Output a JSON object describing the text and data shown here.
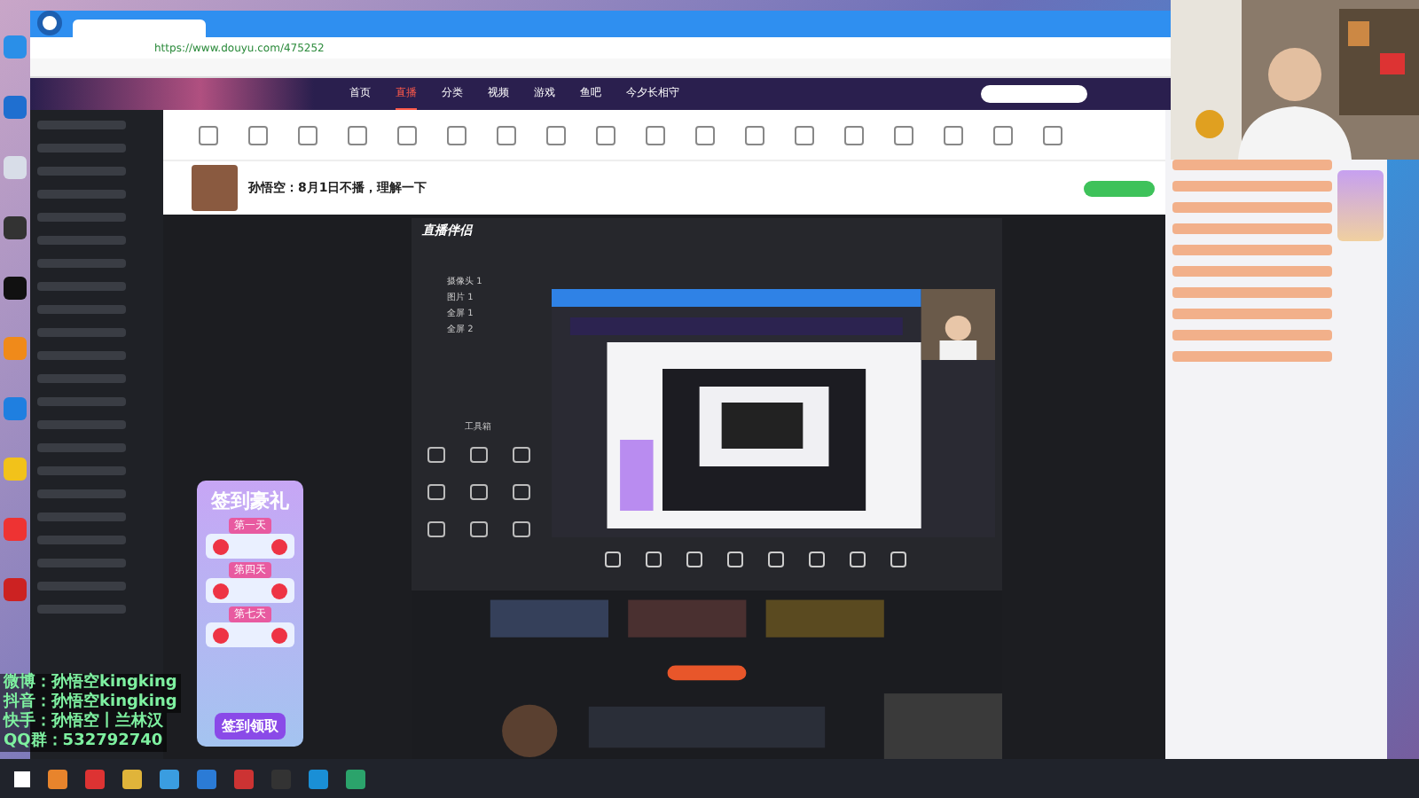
{
  "browser": {
    "url": "https://www.douyu.com/475252"
  },
  "nav": [
    {
      "label": "首页",
      "selected": false
    },
    {
      "label": "直播",
      "selected": true
    },
    {
      "label": "分类",
      "selected": false
    },
    {
      "label": "视频",
      "selected": false
    },
    {
      "label": "游戏",
      "selected": false
    },
    {
      "label": "鱼吧",
      "selected": false
    },
    {
      "label": "今夕长相守",
      "selected": false
    }
  ],
  "stream": {
    "title": "孙悟空：8月1日不播，理解一下"
  },
  "signin_card": {
    "title": "签到豪礼",
    "days": [
      "第一天",
      "第四天",
      "第七天"
    ],
    "button": "签到领取"
  },
  "streamer_app": {
    "name": "直播伴侣",
    "scenes": [
      "摄像头 1",
      "图片 1",
      "全屏 1",
      "全屏 2"
    ],
    "toolbox": "工具箱"
  },
  "social_overlay": [
    {
      "platform": "微博：",
      "handle": "孙悟空kingking"
    },
    {
      "platform": "抖音：",
      "handle": "孙悟空kingking"
    },
    {
      "platform": "快手：",
      "handle": "孙悟空丨兰林汉"
    },
    {
      "platform": "QQ群：",
      "handle": "532792740"
    }
  ]
}
